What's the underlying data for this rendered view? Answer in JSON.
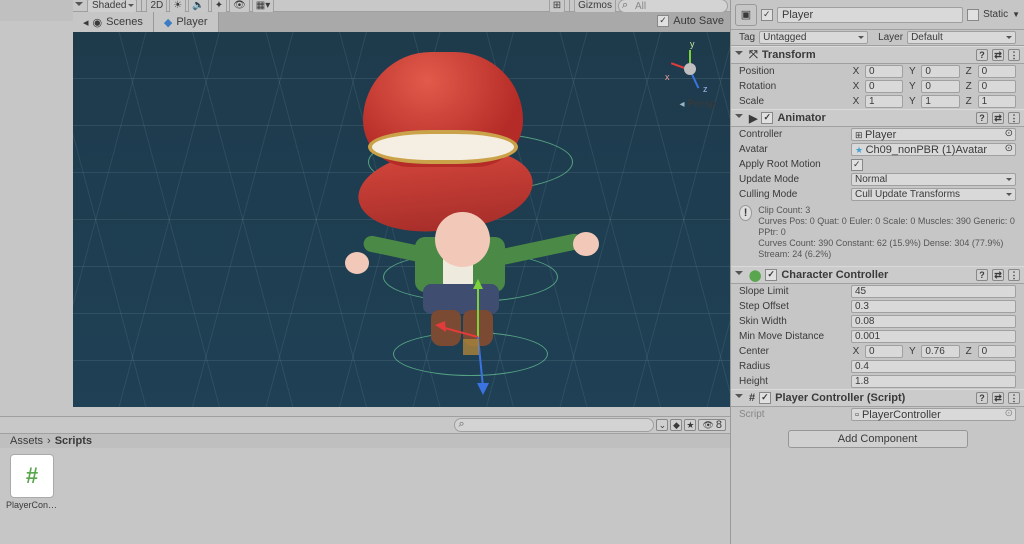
{
  "scene_toolbar": {
    "mode": "Shaded",
    "toggle2d": "2D",
    "gizmos": "Gizmos",
    "search_hint": "All"
  },
  "tabs": {
    "scenes": "Scenes",
    "prefab": "Player"
  },
  "auto_save": "Auto Save",
  "viewport": {
    "persp": "Persp",
    "axis_x": "x",
    "axis_y": "y",
    "axis_z": "z"
  },
  "project": {
    "breadcrumb": [
      "Assets",
      "Scripts"
    ],
    "hidden_count": "8",
    "asset_name": "PlayerCont..."
  },
  "inspector": {
    "obj_name": "Player",
    "static": "Static",
    "tag_lbl": "Tag",
    "tag": "Untagged",
    "layer_lbl": "Layer",
    "layer": "Default",
    "transform": {
      "title": "Transform",
      "position": "Position",
      "rotation": "Rotation",
      "scale": "Scale",
      "pos": {
        "x": "0",
        "y": "0",
        "z": "0"
      },
      "rot": {
        "x": "0",
        "y": "0",
        "z": "0"
      },
      "scl": {
        "x": "1",
        "y": "1",
        "z": "1"
      }
    },
    "animator": {
      "title": "Animator",
      "controller_lbl": "Controller",
      "controller": "Player",
      "avatar_lbl": "Avatar",
      "avatar": "Ch09_nonPBR (1)Avatar",
      "apply_root": "Apply Root Motion",
      "update_mode_lbl": "Update Mode",
      "update_mode": "Normal",
      "culling_lbl": "Culling Mode",
      "culling": "Cull Update Transforms",
      "info1": "Clip Count: 3",
      "info2": "Curves Pos: 0 Quat: 0 Euler: 0 Scale: 0 Muscles: 390 Generic: 0 PPtr: 0",
      "info3": "Curves Count: 390 Constant: 62 (15.9%) Dense: 304 (77.9%) Stream: 24 (6.2%)"
    },
    "cc": {
      "title": "Character Controller",
      "slope_lbl": "Slope Limit",
      "slope": "45",
      "step_lbl": "Step Offset",
      "step": "0.3",
      "skin_lbl": "Skin Width",
      "skin": "0.08",
      "min_lbl": "Min Move Distance",
      "min": "0.001",
      "center_lbl": "Center",
      "cx": "0",
      "cy": "0.76",
      "cz": "0",
      "radius_lbl": "Radius",
      "radius": "0.4",
      "height_lbl": "Height",
      "height": "1.8"
    },
    "pc": {
      "title": "Player Controller (Script)",
      "script_lbl": "Script",
      "script": "PlayerController"
    },
    "add": "Add Component"
  }
}
